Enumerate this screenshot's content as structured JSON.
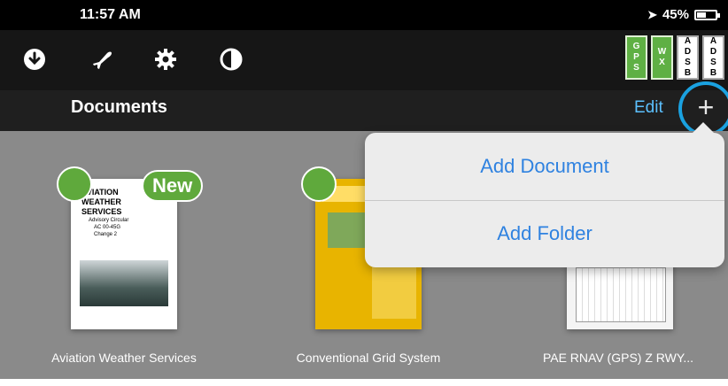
{
  "status_bar": {
    "time": "11:57 AM",
    "battery": "45%"
  },
  "status_boxes": [
    {
      "letters": [
        "G",
        "P",
        "S"
      ],
      "color": "#5fb044"
    },
    {
      "letters": [
        "W",
        "X"
      ],
      "color": "#5fb044"
    },
    {
      "letters": [
        "A",
        "D",
        "S",
        "B"
      ],
      "color": "#ffffff"
    },
    {
      "letters": [
        "A",
        "D",
        "S",
        "B"
      ],
      "color": "#ffffff"
    }
  ],
  "header": {
    "title": "Documents",
    "edit": "Edit",
    "add": "+"
  },
  "documents": [
    {
      "name": "Aviation Weather Services",
      "badge": "New"
    },
    {
      "name": "Conventional Grid System",
      "badge": ""
    },
    {
      "name": "PAE RNAV (GPS) Z RWY...",
      "badge": ""
    }
  ],
  "thumb_text": {
    "line1": "AVIATION",
    "line2": "WEATHER",
    "line3": "SERVICES",
    "line4": "Advisory Circular",
    "line5": "AC 00-45G",
    "line6": "Change 2"
  },
  "popover": {
    "add_document": "Add Document",
    "add_folder": "Add Folder"
  },
  "colors": {
    "accent": "#2f82e0",
    "edit": "#5cc1ff",
    "ring": "#1aa1e0",
    "green": "#5fa93c"
  }
}
